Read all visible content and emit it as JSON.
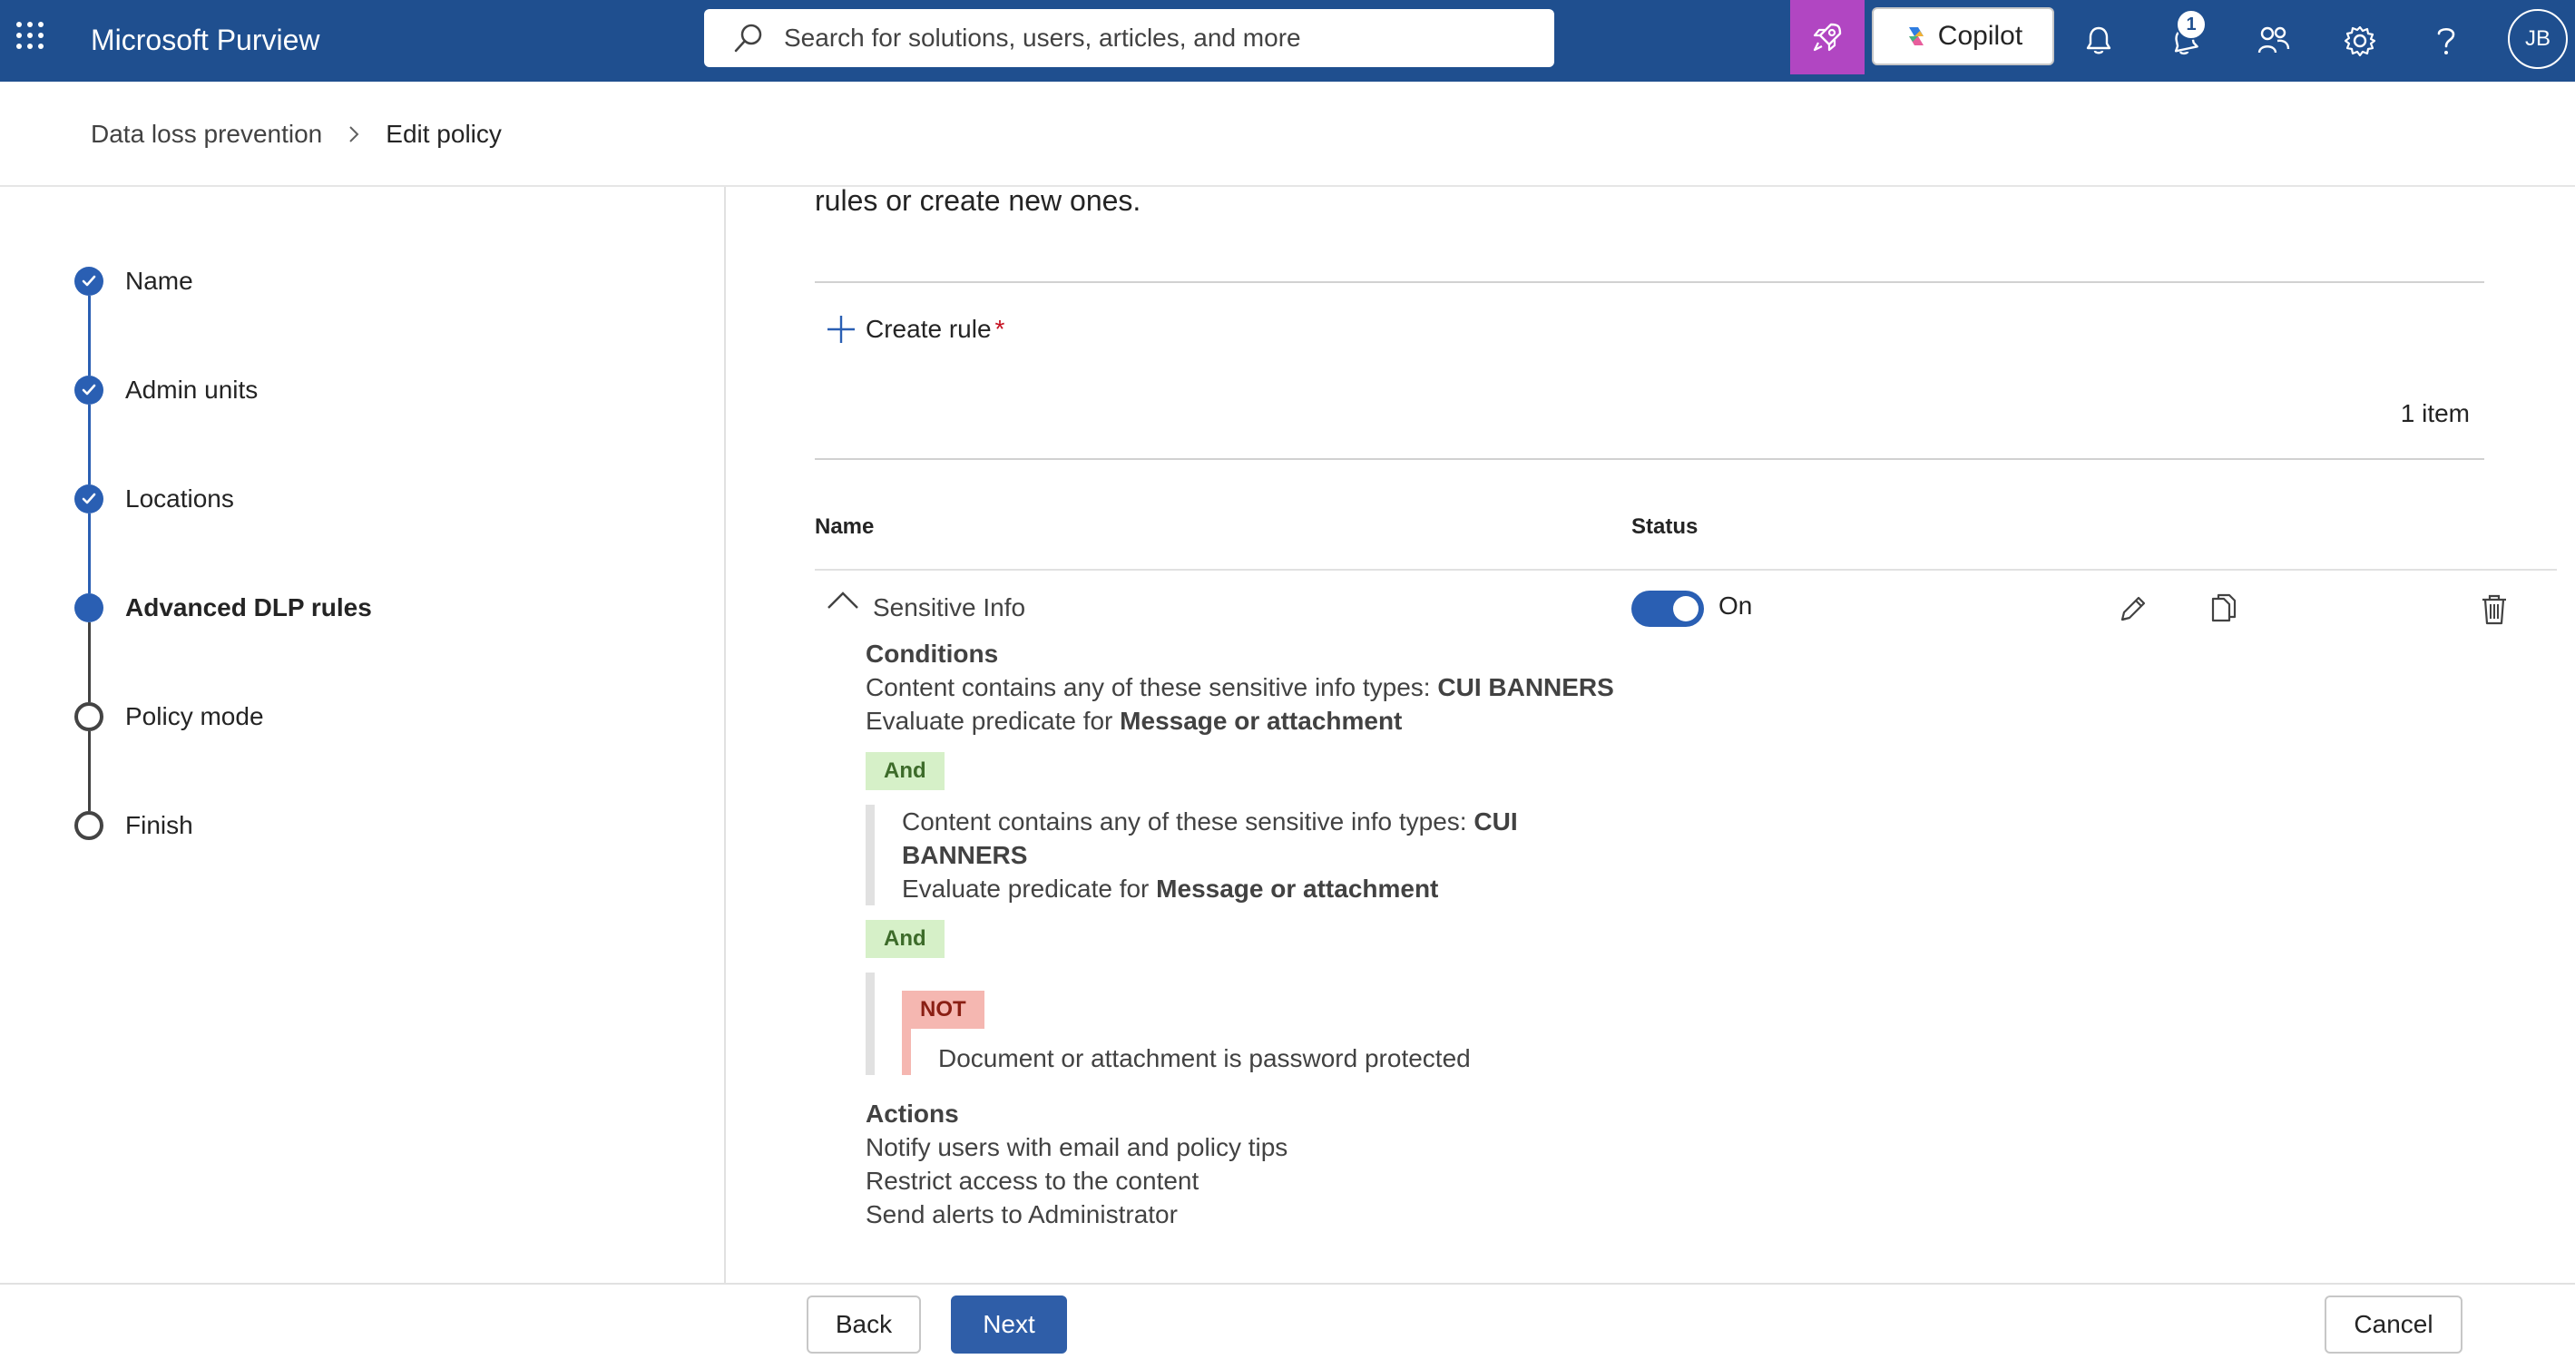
{
  "topbar": {
    "app_name": "Microsoft Purview",
    "search_placeholder": "Search for solutions, users, articles, and more",
    "copilot_label": "Copilot",
    "notification_count": "1",
    "avatar_initials": "JB",
    "accent_color": "#1f4f8f"
  },
  "breadcrumb": {
    "parent": "Data loss prevention",
    "current": "Edit policy"
  },
  "wizard": {
    "steps": [
      {
        "label": "Name",
        "state": "completed"
      },
      {
        "label": "Admin units",
        "state": "completed"
      },
      {
        "label": "Locations",
        "state": "completed"
      },
      {
        "label": "Advanced DLP rules",
        "state": "current"
      },
      {
        "label": "Policy mode",
        "state": "not-started"
      },
      {
        "label": "Finish",
        "state": "not-started"
      }
    ]
  },
  "main": {
    "intro_tail": "rules or create new ones.",
    "create_rule_label": "Create rule",
    "required_marker": "*",
    "item_count": "1 item",
    "columns": {
      "name": "Name",
      "status": "Status"
    },
    "rule": {
      "name": "Sensitive Info",
      "status_label": "On",
      "enabled": true,
      "conditions_heading": "Conditions",
      "cond1_prefix": "Content contains any of these sensitive info types: ",
      "cond1_value": "CUI BANNERS",
      "cond1_eval_prefix": "Evaluate predicate for ",
      "cond1_eval_value": "Message or attachment",
      "and_label": "And",
      "cond2_prefix": "Content contains any of these sensitive info types: ",
      "cond2_value": "CUI BANNERS",
      "cond2_eval_prefix": "Evaluate predicate for ",
      "cond2_eval_value": "Message or attachment",
      "and2_label": "And",
      "not_label": "NOT",
      "not_condition": "Document or attachment is password protected",
      "actions_heading": "Actions",
      "actions": [
        "Notify users with email and policy tips",
        "Restrict access to the content",
        "Send alerts to Administrator"
      ]
    }
  },
  "footer": {
    "back_label": "Back",
    "next_label": "Next",
    "cancel_label": "Cancel"
  },
  "icons": {
    "waffle": "app-launcher-icon",
    "search": "search-icon",
    "rocket": "rocket-icon",
    "copilot": "copilot-icon",
    "bell": "bell-icon",
    "alert": "alert-bell-icon",
    "people": "people-icon",
    "gear": "gear-icon",
    "help": "help-icon",
    "edit": "pencil-icon",
    "copy": "copy-icon",
    "delete": "trash-icon"
  }
}
